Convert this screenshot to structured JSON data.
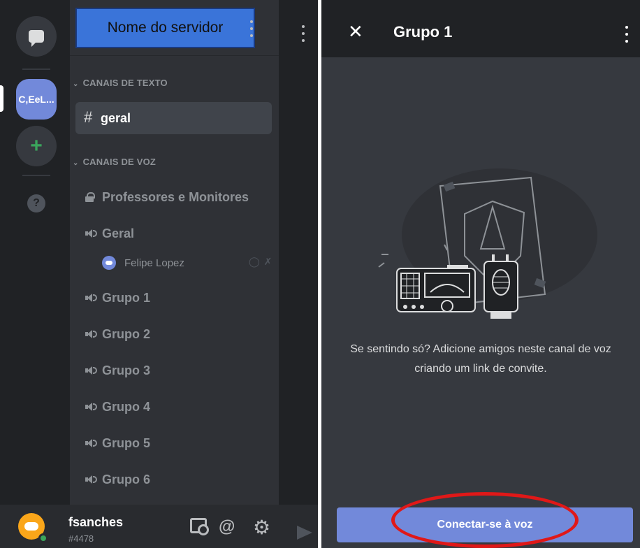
{
  "left_panel": {
    "server_icon_label": "C,EeL...",
    "server_name": "Nome do servidor",
    "add_server_glyph": "+",
    "help_glyph": "?",
    "text_category": "CANAIS DE TEXTO",
    "selected_text_channel": "geral",
    "voice_category": "CANAIS DE VOZ",
    "voice_channels": [
      {
        "label": "Professores e Monitores",
        "icon": "lock-icon"
      },
      {
        "label": "Geral",
        "icon": "speaker-icon"
      },
      {
        "label": "Grupo 1",
        "icon": "speaker-icon"
      },
      {
        "label": "Grupo 2",
        "icon": "speaker-icon"
      },
      {
        "label": "Grupo 3",
        "icon": "speaker-icon"
      },
      {
        "label": "Grupo 4",
        "icon": "speaker-icon"
      },
      {
        "label": "Grupo 5",
        "icon": "speaker-icon"
      },
      {
        "label": "Grupo 6",
        "icon": "speaker-icon"
      }
    ],
    "voice_member": "Felipe Lopez",
    "user": {
      "name": "fsanches",
      "tag": "#4478"
    }
  },
  "right_panel": {
    "title": "Grupo 1",
    "message": "Se sentindo só? Adicione amigos neste canal de voz criando um link de convite.",
    "connect_button": "Conectar-se à voz"
  },
  "colors": {
    "blurple": "#7289da",
    "annotation_red": "#e01818",
    "annotation_box": "#3a74d9",
    "online_green": "#3ba55c"
  }
}
